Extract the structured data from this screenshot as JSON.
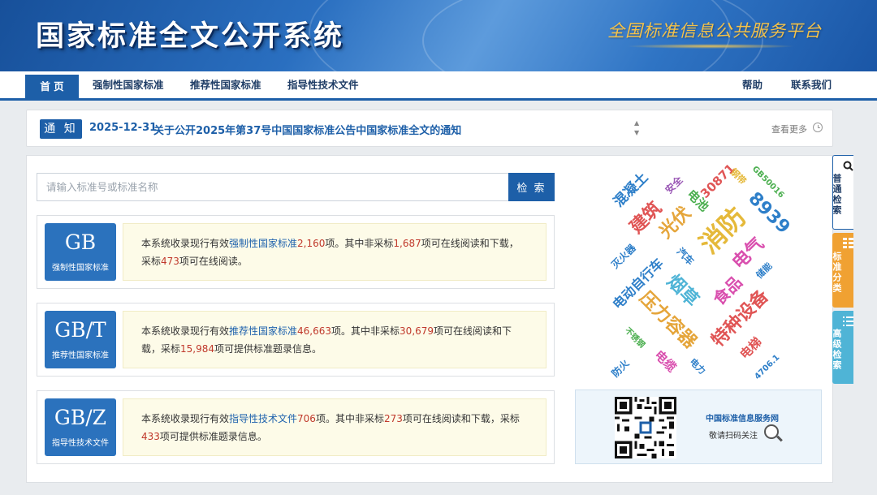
{
  "header": {
    "title": "国家标准全文公开系统",
    "slogan": "全国标准信息公共服务平台"
  },
  "nav": {
    "home": "首 页",
    "mandatory": "强制性国家标准",
    "recommended": "推荐性国家标准",
    "guidance": "指导性技术文件",
    "help": "帮助",
    "contact": "联系我们"
  },
  "notice": {
    "badge": "通 知",
    "date": "2025-12-31",
    "text": "关于公开2025年第37号中国国家标准公告中国家标准全文的通知",
    "more": "查看更多"
  },
  "search": {
    "placeholder": "请输入标准号或标准名称",
    "button": "检 索"
  },
  "cards": [
    {
      "code": "GB",
      "type": "强制性国家标准",
      "t1": "本系统收录现行有效",
      "link": "强制性国家标准",
      "n1": "2,160",
      "t2": "项。其中非采标",
      "n2": "1,687",
      "t3": "项可在线阅读和下载，采标",
      "n3": "473",
      "t4": "项可在线阅读。"
    },
    {
      "code": "GB/T",
      "type": "推荐性国家标准",
      "t1": "本系统收录现行有效",
      "link": "推荐性国家标准",
      "n1": "46,663",
      "t2": "项。其中非采标",
      "n2": "30,679",
      "t3": "项可在线阅读和下载，采标",
      "n3": "15,984",
      "t4": "项可提供标准题录信息。"
    },
    {
      "code": "GB/Z",
      "type": "指导性技术文件",
      "t1": "本系统收录现行有效",
      "link": "指导性技术文件",
      "n1": "706",
      "t2": "项。其中非采标",
      "n2": "273",
      "t3": "项可在线阅读和下载，采标",
      "n3": "433",
      "t4": "项可提供标准题录信息。"
    }
  ],
  "cloud": [
    {
      "text": "混凝土",
      "color": "#2e7fc9"
    },
    {
      "text": "安全",
      "color": "#9b59b6"
    },
    {
      "text": "30871",
      "color": "#e05555"
    },
    {
      "text": "钢带",
      "color": "#e5b93a"
    },
    {
      "text": "GB50016",
      "color": "#4caf50"
    },
    {
      "text": "电池",
      "color": "#4caf50"
    },
    {
      "text": "8939",
      "color": "#2e7fc9"
    },
    {
      "text": "建筑",
      "color": "#e05555"
    },
    {
      "text": "光伏",
      "color": "#e5a53a"
    },
    {
      "text": "消防",
      "color": "#e5b93a"
    },
    {
      "text": "灭火器",
      "color": "#2e7fc9"
    },
    {
      "text": "汽车",
      "color": "#2e7fc9"
    },
    {
      "text": "电气",
      "color": "#d94fae"
    },
    {
      "text": "储能",
      "color": "#2e7fc9"
    },
    {
      "text": "电动自行车",
      "color": "#2e7fc9"
    },
    {
      "text": "烟草",
      "color": "#4fb4d6"
    },
    {
      "text": "食品",
      "color": "#d94fae"
    },
    {
      "text": "压力容器",
      "color": "#e5a53a"
    },
    {
      "text": "特种设备",
      "color": "#e05555"
    },
    {
      "text": "不锈钢",
      "color": "#4caf50"
    },
    {
      "text": "电梯",
      "color": "#e05555"
    },
    {
      "text": "防火",
      "color": "#2e7fc9"
    },
    {
      "text": "电缆",
      "color": "#d94fae"
    },
    {
      "text": "电力",
      "color": "#2e7fc9"
    },
    {
      "text": "4706.1",
      "color": "#2e7fc9"
    }
  ],
  "qr": {
    "title": "中国标准信息服务网",
    "subtitle": "敬请扫码关注"
  },
  "side_tabs": {
    "basic": "普通检索",
    "category": "标准分类",
    "advanced": "高级检索"
  }
}
